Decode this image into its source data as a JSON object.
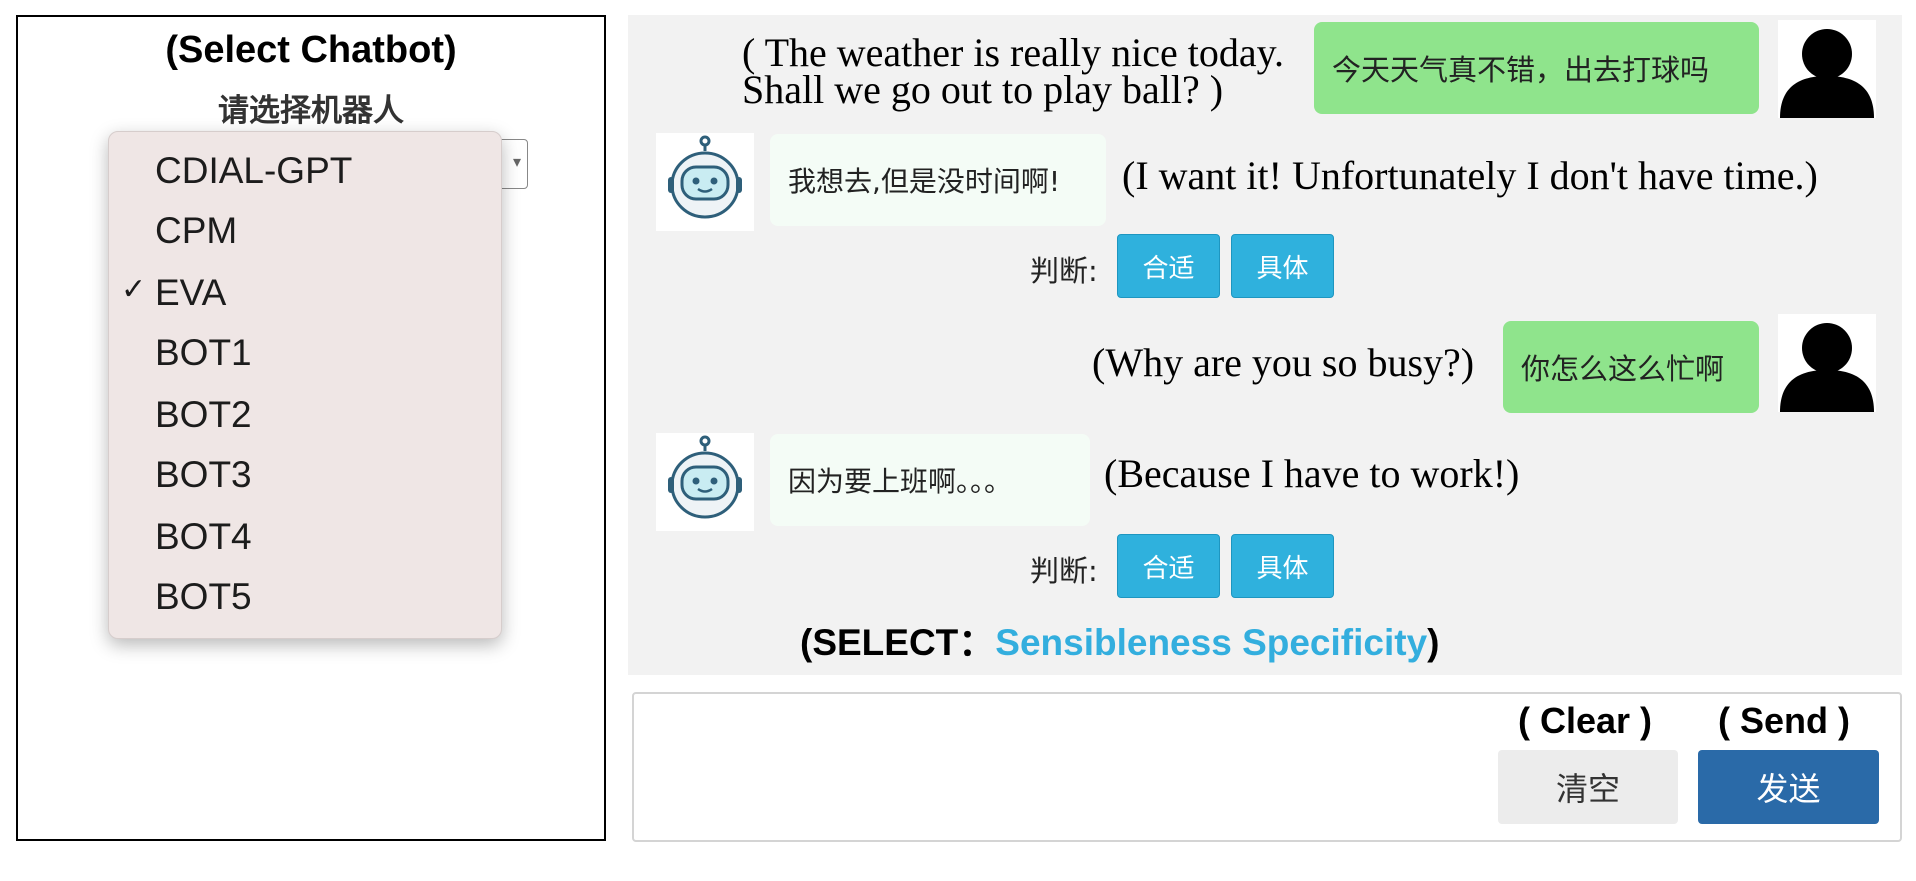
{
  "left_panel": {
    "title_en": "(Select Chatbot)",
    "title_zh": "请选择机器人",
    "selected": "EVA",
    "options": [
      {
        "label": "CDIAL-GPT",
        "check": ""
      },
      {
        "label": "CPM",
        "check": ""
      },
      {
        "label": "EVA",
        "check": "✓"
      },
      {
        "label": "BOT1",
        "check": ""
      },
      {
        "label": "BOT2",
        "check": ""
      },
      {
        "label": "BOT3",
        "check": ""
      },
      {
        "label": "BOT4",
        "check": ""
      },
      {
        "label": "BOT5",
        "check": ""
      }
    ]
  },
  "chat": {
    "messages": [
      {
        "role": "user",
        "text": "今天天气真不错，出去打球吗",
        "translation_line1": "( The weather is really nice today.",
        "translation_line2": "Shall we go out to play ball? )"
      },
      {
        "role": "bot",
        "text": "我想去,但是没时间啊!",
        "translation": "(I want it! Unfortunately I don't have time.)"
      },
      {
        "role": "user",
        "text": "你怎么这么忙啊",
        "translation": "(Why are you so busy?)"
      },
      {
        "role": "bot",
        "text": "因为要上班啊。。。",
        "translation": "(Because I have to work!)"
      }
    ],
    "judge_label": "判断:",
    "judge_buttons": [
      "合适",
      "具体"
    ],
    "select_note": {
      "prefix": "(SELECT：",
      "highlight": "Sensibleness Specificity",
      "suffix": ")"
    }
  },
  "input": {
    "clear_caption": "( Clear )",
    "send_caption": "( Send )",
    "clear_label": "清空",
    "send_label": "发送"
  },
  "colors": {
    "user_bubble": "#8fe48c",
    "bot_bubble": "#f4fcf6",
    "judge_button": "#2fb1dd",
    "highlight": "#33aede",
    "send_button": "#2a6aa8",
    "chat_bg": "#f2f2f2",
    "dropdown_bg": "#efe6e5"
  },
  "icons": {
    "user_avatar": "person-silhouette-icon",
    "bot_avatar": "robot-icon",
    "select_arrow": "chevron-down-icon",
    "checkmark": "checkmark-icon"
  }
}
